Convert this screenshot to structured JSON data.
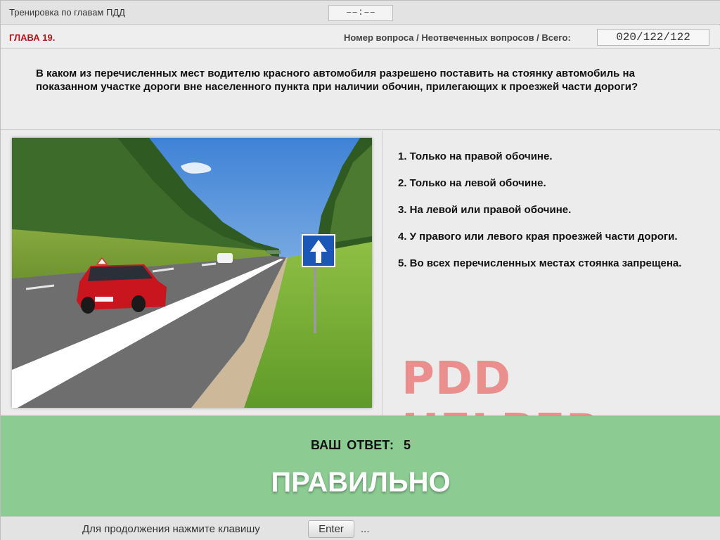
{
  "header": {
    "app_title": "Тренировка по главам ПДД",
    "timer": "––:––"
  },
  "chapter": {
    "label": "ГЛАВА 19.",
    "counter_label": "Номер вопроса / Неотвеченных вопросов / Всего:",
    "counter_value": "020/122/122"
  },
  "question": {
    "text": "В каком из перечисленных мест водителю красного автомобиля разрешено поставить на стоянку автомобиль на показанном участке дороги вне населенного пункта при наличии обочин, прилегающих к проезжей части дороги?"
  },
  "answers": [
    "1.  Только на правой обочине.",
    "2.  Только на левой обочине.",
    "3.  На левой или правой обочине.",
    "4.  У правого или левого края проезжей части дороги.",
    "5.  Во всех перечисленных местах стоянка запрещена."
  ],
  "watermark": "PDD HELPER",
  "result": {
    "label": "ВАШ  ОТВЕТ:",
    "value": "5",
    "verdict": "ПРАВИЛЬНО",
    "color": "#8ccc93"
  },
  "footer": {
    "hint": "Для продолжения нажмите клавишу",
    "key": "Enter",
    "ellipsis": "..."
  },
  "colors": {
    "chapter": "#b01818",
    "watermark": "#ea8a8a"
  }
}
